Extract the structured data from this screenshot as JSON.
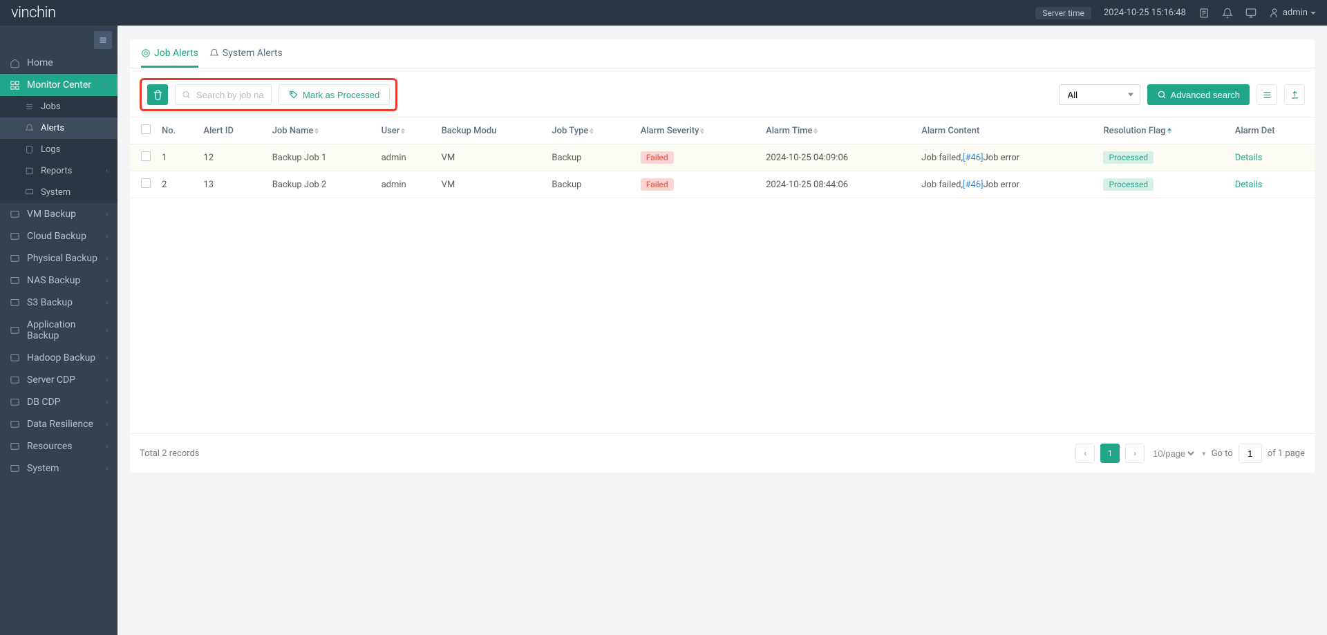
{
  "topbar": {
    "logo": "vinchin",
    "server_label": "Server time",
    "server_time": "2024-10-25 15:16:48",
    "user": "admin"
  },
  "sidebar": {
    "home": "Home",
    "monitor": "Monitor Center",
    "monitor_items": [
      "Jobs",
      "Alerts",
      "Logs",
      "Reports",
      "System"
    ],
    "menus": [
      "VM Backup",
      "Cloud Backup",
      "Physical Backup",
      "NAS Backup",
      "S3 Backup",
      "Application Backup",
      "Hadoop Backup",
      "Server CDP",
      "DB CDP",
      "Data Resilience",
      "Resources",
      "System"
    ]
  },
  "tabs": {
    "job": "Job Alerts",
    "system": "System Alerts"
  },
  "toolbar": {
    "search_ph": "Search by job nan",
    "mark": "Mark as Processed",
    "filter": "All",
    "adv": "Advanced search"
  },
  "columns": [
    "No.",
    "Alert ID",
    "Job Name",
    "User",
    "Backup Modu",
    "Job Type",
    "Alarm Severity",
    "Alarm Time",
    "Alarm Content",
    "Resolution Flag",
    "Alarm Det"
  ],
  "rows": [
    {
      "no": "1",
      "alert_id": "12",
      "job": "Backup Job 1",
      "user": "admin",
      "module": "VM",
      "type": "Backup",
      "severity": "Failed",
      "time": "2024-10-25 04:09:06",
      "content_pre": "Job failed,",
      "content_code": "[#46]",
      "content_post": "Job error",
      "flag": "Processed",
      "details": "Details"
    },
    {
      "no": "2",
      "alert_id": "13",
      "job": "Backup Job 2",
      "user": "admin",
      "module": "VM",
      "type": "Backup",
      "severity": "Failed",
      "time": "2024-10-25 08:44:06",
      "content_pre": "Job failed,",
      "content_code": "[#46]",
      "content_post": "Job error",
      "flag": "Processed",
      "details": "Details"
    }
  ],
  "footer": {
    "total": "Total 2 records",
    "page": "1",
    "per": "10/page",
    "goto": "Go to",
    "goto_val": "1",
    "of": "of 1 page"
  }
}
